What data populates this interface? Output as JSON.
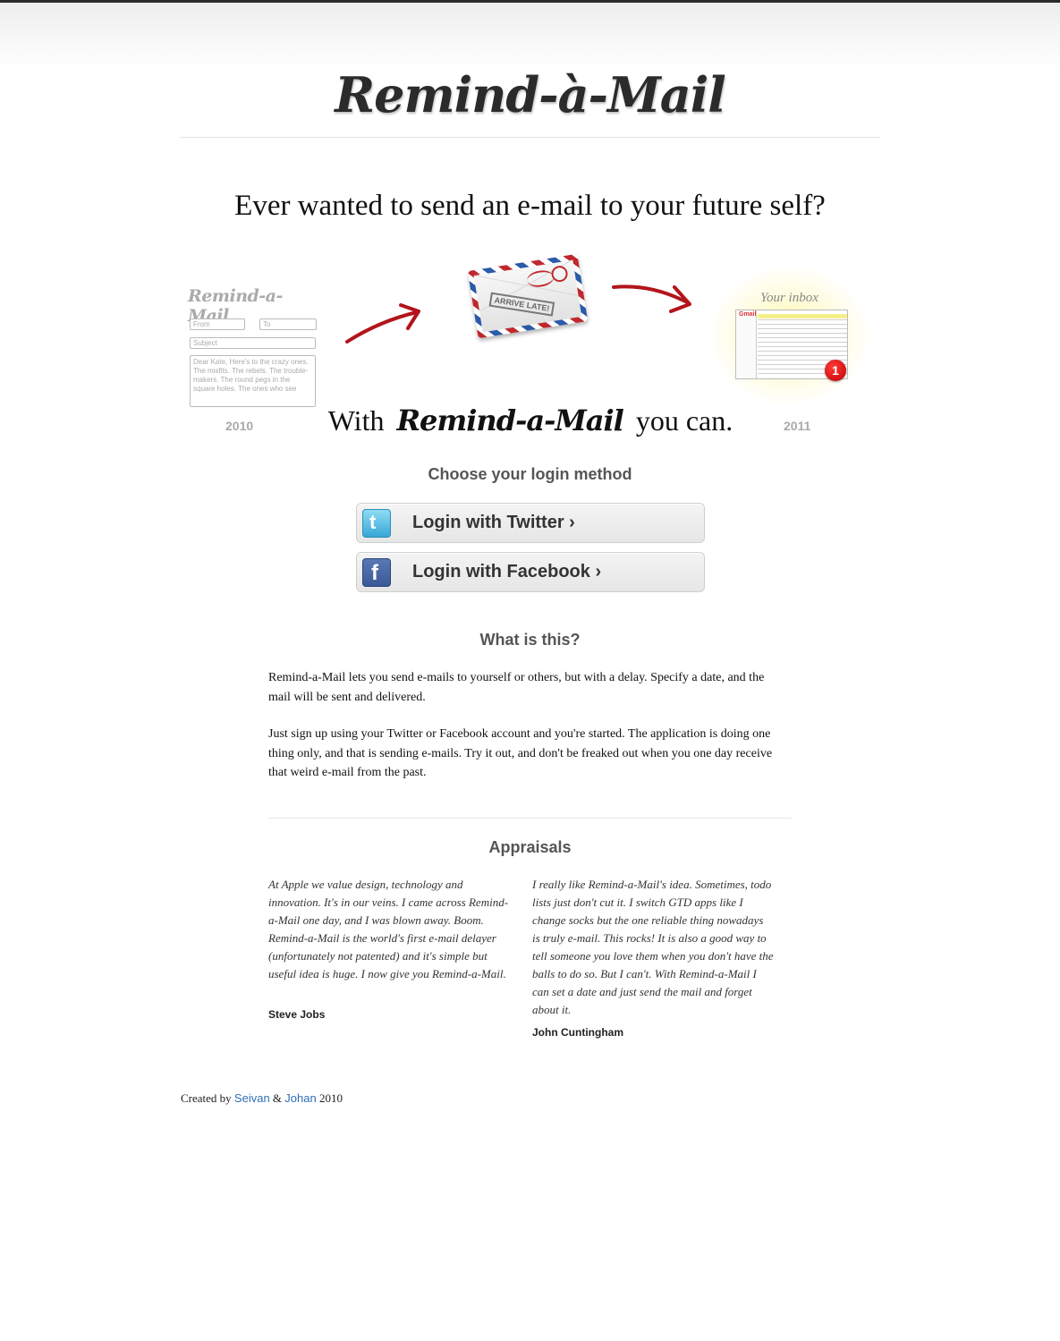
{
  "site": {
    "logo": "Remind-à-Mail"
  },
  "hero": {
    "headline": "Ever wanted to send an e-mail to your future self?",
    "form": {
      "logo": "Remind-a-Mail",
      "from_placeholder": "From",
      "to_placeholder": "To",
      "subject_placeholder": "Subject",
      "body": "Dear Kate,\nHere's to the crazy ones. The misfits. The rebels. The trouble-makers. The round pegs in the square holes. The ones who see",
      "year": "2010"
    },
    "envelope_stamp": "ARRIVE LATE!",
    "inbox": {
      "label": "Your inbox",
      "brand": "Gmail",
      "unread_count": "1",
      "year": "2011"
    },
    "tagline_before": "With",
    "tagline_brand": "Remind-a-Mail",
    "tagline_after": "you can."
  },
  "login": {
    "heading": "Choose your login method",
    "twitter_label": "Login with Twitter ›",
    "facebook_label": "Login with Facebook ›",
    "twitter_icon_glyph": "t",
    "facebook_icon_glyph": "f"
  },
  "about": {
    "heading": "What is this?",
    "p1": "Remind-a-Mail lets you send e-mails to yourself or others, but with a delay. Specify a date, and the mail will be sent and delivered.",
    "p2": "Just sign up using your Twitter or Facebook account and you're started. The application is doing one thing only, and that is sending e-mails. Try it out, and don't be freaked out when you one day receive that weird e-mail from the past."
  },
  "appraisals": {
    "heading": "Appraisals",
    "items": [
      {
        "quote": "At Apple we value design, technology and innovation. It's in our veins. I came across Remind-a-Mail one day, and I was blown away. Boom. Remind-a-Mail is the world's first e-mail delayer (unfortunately not patented) and it's simple but useful idea is huge. I now give you Remind-a-Mail.",
        "author": "Steve Jobs"
      },
      {
        "quote": "I really like Remind-a-Mail's idea. Sometimes, todo lists just don't cut it. I switch GTD apps like I change socks but the one reliable thing nowadays is truly e-mail. This rocks! It is also a good way to tell someone you love them when you don't have the balls to do so. But I can't. With Remind-a-Mail I can set a date and just send the mail and forget about it.",
        "author": "John Cuntingham"
      }
    ]
  },
  "footer": {
    "prefix": "Created by",
    "author1": "Seivan",
    "amp": "&",
    "author2": "Johan",
    "year": "2010"
  },
  "colors": {
    "link": "#2f6fb5",
    "heading_gray": "#555555",
    "arrow_red": "#b3141b",
    "badge_red": "#d10000"
  }
}
